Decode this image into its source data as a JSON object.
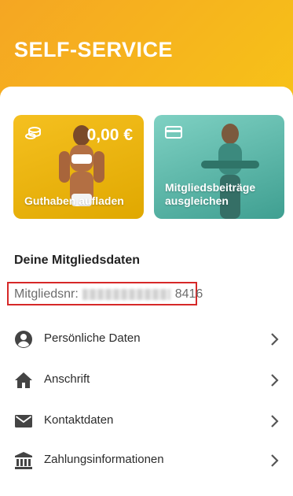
{
  "header": {
    "title": "SELF-SERVICE"
  },
  "cards": {
    "guthaben": {
      "amount": "0,00 €",
      "label": "Guthaben aufladen"
    },
    "beitrag": {
      "label_line1": "Mitgliedsbeiträge",
      "label_line2": "ausgleichen"
    }
  },
  "member": {
    "section_title": "Deine Mitgliedsdaten",
    "number_prefix": "Mitgliedsnr:",
    "number_suffix": "8416"
  },
  "menu": {
    "items": [
      {
        "label": "Persönliche Daten",
        "icon": "person-icon"
      },
      {
        "label": "Anschrift",
        "icon": "home-icon"
      },
      {
        "label": "Kontaktdaten",
        "icon": "mail-icon"
      },
      {
        "label": "Zahlungsinformationen",
        "icon": "bank-icon"
      }
    ]
  },
  "colors": {
    "accent": "#f7c417",
    "highlight_border": "#d62828",
    "card_yellow": "#f5c020",
    "card_teal": "#5fb8aa"
  }
}
